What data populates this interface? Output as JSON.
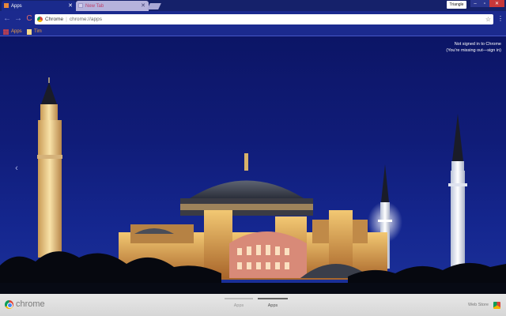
{
  "tabs": [
    {
      "label": "Apps",
      "active": true
    },
    {
      "label": "New Tab",
      "active": false
    }
  ],
  "window": {
    "profile_label": "Triangle",
    "min_glyph": "–",
    "max_glyph": "▫",
    "close_glyph": "✕"
  },
  "toolbar": {
    "back_glyph": "←",
    "forward_glyph": "→",
    "reload_glyph": "C",
    "omnibox_chip": "Chrome",
    "omnibox_url": "chrome://apps",
    "star_glyph": "☆",
    "menu_glyph": "⋮"
  },
  "bookmarks": [
    {
      "label": "Apps"
    },
    {
      "label": "Tim"
    }
  ],
  "signin": {
    "line1": "Not signed in to Chrome",
    "line2": "(You're missing out—sign in)"
  },
  "carousel": {
    "left_glyph": "‹"
  },
  "bottom": {
    "brand": "chrome",
    "pages": [
      "Apps",
      "Apps"
    ],
    "webstore_label": "Web Store"
  },
  "colors": {
    "accent": "#1b2a8e",
    "sky": "#101c78",
    "close": "#c8383a"
  }
}
